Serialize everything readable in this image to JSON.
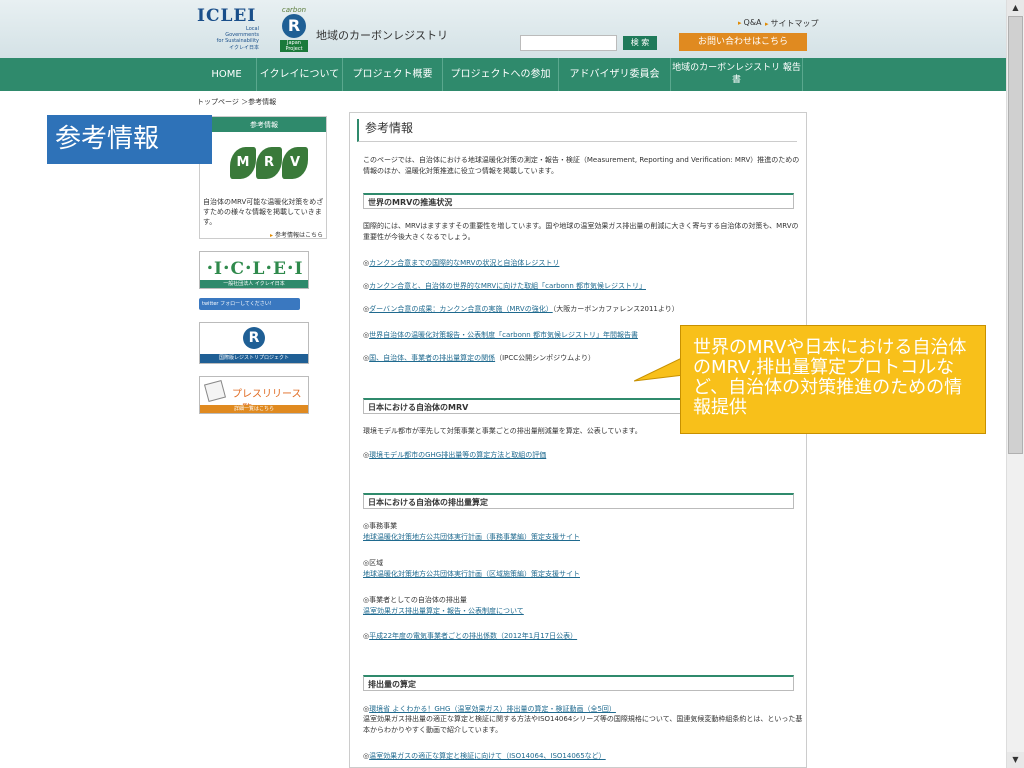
{
  "header": {
    "iclei_logo": "ICLEI",
    "iclei_sub1": "Local",
    "iclei_sub2": "Governments",
    "iclei_sub3": "for Sustainability",
    "iclei_jp": "イクレイ日本",
    "carbon_sup": "carbon",
    "carbon_r": "R",
    "carbon_tag": "Japan Project",
    "site_name": "地域のカーボンレジストリ",
    "util_qa": "Q&A",
    "util_sitemap": "サイトマップ",
    "search_placeholder": "",
    "search_button": "検 索",
    "contact_button": "お問い合わせはこちら"
  },
  "nav": {
    "items": [
      "HOME",
      "イクレイについて",
      "プロジェクト概要",
      "プロジェクトへの参加",
      "アドバイザリ委員会",
      "地域のカーボンレジストリ 報告書"
    ]
  },
  "breadcrumb": "トップページ ＞参考情報",
  "sidebar": {
    "box_head": "参考情報",
    "leaves": [
      "M",
      "R",
      "V"
    ],
    "box_desc": "自治体のMRV可能な温暖化対策をめざすための様々な情報を掲載していきます。",
    "box_link": "参考情報はこちら",
    "iclei_banner": "･I･C･L･E･I",
    "iclei_banner_sub": "一般社団法人 イクレイ日本",
    "twitter_banner": "twitter フォローしてください!",
    "registry_banner_sub": "国際版レジストリプロジェクト",
    "press_banner": "プレスリリース一覧",
    "press_banner_sub": "詳細一覧はこちら"
  },
  "main": {
    "title": "参考情報",
    "intro": "このページでは、自治体における地球温暖化対策の測定・報告・検証（Measurement, Reporting and Verification: MRV）推進のための情報のほか、温暖化対策推進に役立つ情報を掲載しています。",
    "sec1_title": "世界のMRVの推進状況",
    "sec1_text": "国際的には、MRVはますますその重要性を増しています。国や地球の温室効果ガス排出量の削減に大きく寄与する自治体の対策も、MRVの重要性が今後大きくなるでしょう。",
    "sec1_links": [
      "カンクン合意までの国際的なMRVの状況と自治体レジストリ",
      "カンクン合意と、自治体の世界的なMRVに向けた取組「carbonn 都市気候レジストリ」",
      "ダーバン合意の成果：カンクン合意の実施（MRVの強化）",
      "世界自治体の温暖化対策報告・公表制度「carbonn 都市気候レジストリ」年間報告書",
      "国、自治体、事業者の排出量算定の関係"
    ],
    "sec1_link3_suffix": "（大阪カーボンカファレンス2011より）",
    "sec1_link5_suffix": "（IPCC公開シンポジウムより）",
    "sec2_title": "日本における自治体のMRV",
    "sec2_text": "環境モデル都市が率先して対策事業と事業ごとの排出量削減量を算定、公表しています。",
    "sec2_link": "環境モデル都市のGHG排出量等の算定方法と取組の評価",
    "sec3_title": "日本における自治体の排出量算定",
    "sec3_item1_label": "◎事務事業",
    "sec3_item1_link": "地球温暖化対策地方公共団体実行計画（事務事業編）策定支援サイト",
    "sec3_item2_label": "◎区域",
    "sec3_item2_link": "地球温暖化対策地方公共団体実行計画（区域施策編）策定支援サイト",
    "sec3_item3_label": "◎事業者としての自治体の排出量",
    "sec3_item3_link": "温室効果ガス排出量算定・報告・公表制度について",
    "sec3_link4": "平成22年度の電気事業者ごとの排出係数（2012年1月17日公表）",
    "sec4_title": "排出量の算定",
    "sec4_link1": "環境省 よくわかる！GHG（温室効果ガス）排出量の算定・検証動画（全5回）",
    "sec4_text": "温室効果ガス排出量の適正な算定と検証に関する方法やISO14064シリーズ等の国際規格について、国連気候変動枠組条約とは、といった基本からわかりやすく動画で紹介しています。",
    "sec4_link2": "温室効果ガスの適正な算定と検証に向けて（ISO14064、ISO14065など）"
  },
  "overlay": {
    "label": "参考情報",
    "callout": "世界のMRVや日本における自治体のMRV,排出量算定プロトコルなど、自治体の対策推進のための情報提供"
  },
  "colors": {
    "green": "#2f8a6c",
    "orange": "#e08a20",
    "label_blue": "#2e72b8",
    "callout_yellow": "#f8c01a"
  }
}
